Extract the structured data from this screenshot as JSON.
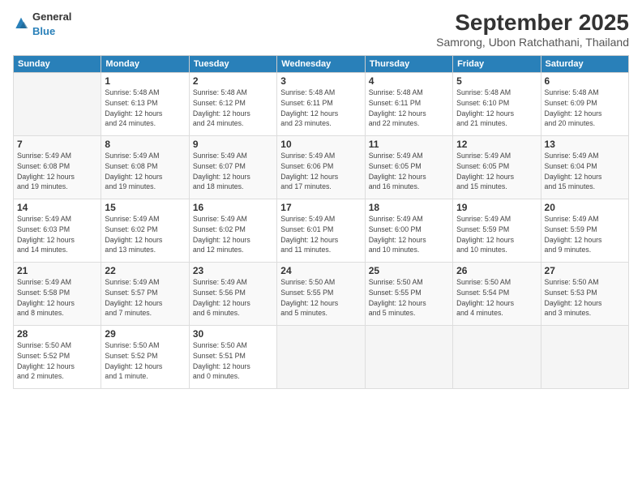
{
  "header": {
    "logo_general": "General",
    "logo_blue": "Blue",
    "month_title": "September 2025",
    "subtitle": "Samrong, Ubon Ratchathani, Thailand"
  },
  "weekdays": [
    "Sunday",
    "Monday",
    "Tuesday",
    "Wednesday",
    "Thursday",
    "Friday",
    "Saturday"
  ],
  "weeks": [
    [
      {
        "day": "",
        "info": ""
      },
      {
        "day": "1",
        "info": "Sunrise: 5:48 AM\nSunset: 6:13 PM\nDaylight: 12 hours\nand 24 minutes."
      },
      {
        "day": "2",
        "info": "Sunrise: 5:48 AM\nSunset: 6:12 PM\nDaylight: 12 hours\nand 24 minutes."
      },
      {
        "day": "3",
        "info": "Sunrise: 5:48 AM\nSunset: 6:11 PM\nDaylight: 12 hours\nand 23 minutes."
      },
      {
        "day": "4",
        "info": "Sunrise: 5:48 AM\nSunset: 6:11 PM\nDaylight: 12 hours\nand 22 minutes."
      },
      {
        "day": "5",
        "info": "Sunrise: 5:48 AM\nSunset: 6:10 PM\nDaylight: 12 hours\nand 21 minutes."
      },
      {
        "day": "6",
        "info": "Sunrise: 5:48 AM\nSunset: 6:09 PM\nDaylight: 12 hours\nand 20 minutes."
      }
    ],
    [
      {
        "day": "7",
        "info": "Sunrise: 5:49 AM\nSunset: 6:08 PM\nDaylight: 12 hours\nand 19 minutes."
      },
      {
        "day": "8",
        "info": "Sunrise: 5:49 AM\nSunset: 6:08 PM\nDaylight: 12 hours\nand 19 minutes."
      },
      {
        "day": "9",
        "info": "Sunrise: 5:49 AM\nSunset: 6:07 PM\nDaylight: 12 hours\nand 18 minutes."
      },
      {
        "day": "10",
        "info": "Sunrise: 5:49 AM\nSunset: 6:06 PM\nDaylight: 12 hours\nand 17 minutes."
      },
      {
        "day": "11",
        "info": "Sunrise: 5:49 AM\nSunset: 6:05 PM\nDaylight: 12 hours\nand 16 minutes."
      },
      {
        "day": "12",
        "info": "Sunrise: 5:49 AM\nSunset: 6:05 PM\nDaylight: 12 hours\nand 15 minutes."
      },
      {
        "day": "13",
        "info": "Sunrise: 5:49 AM\nSunset: 6:04 PM\nDaylight: 12 hours\nand 15 minutes."
      }
    ],
    [
      {
        "day": "14",
        "info": "Sunrise: 5:49 AM\nSunset: 6:03 PM\nDaylight: 12 hours\nand 14 minutes."
      },
      {
        "day": "15",
        "info": "Sunrise: 5:49 AM\nSunset: 6:02 PM\nDaylight: 12 hours\nand 13 minutes."
      },
      {
        "day": "16",
        "info": "Sunrise: 5:49 AM\nSunset: 6:02 PM\nDaylight: 12 hours\nand 12 minutes."
      },
      {
        "day": "17",
        "info": "Sunrise: 5:49 AM\nSunset: 6:01 PM\nDaylight: 12 hours\nand 11 minutes."
      },
      {
        "day": "18",
        "info": "Sunrise: 5:49 AM\nSunset: 6:00 PM\nDaylight: 12 hours\nand 10 minutes."
      },
      {
        "day": "19",
        "info": "Sunrise: 5:49 AM\nSunset: 5:59 PM\nDaylight: 12 hours\nand 10 minutes."
      },
      {
        "day": "20",
        "info": "Sunrise: 5:49 AM\nSunset: 5:59 PM\nDaylight: 12 hours\nand 9 minutes."
      }
    ],
    [
      {
        "day": "21",
        "info": "Sunrise: 5:49 AM\nSunset: 5:58 PM\nDaylight: 12 hours\nand 8 minutes."
      },
      {
        "day": "22",
        "info": "Sunrise: 5:49 AM\nSunset: 5:57 PM\nDaylight: 12 hours\nand 7 minutes."
      },
      {
        "day": "23",
        "info": "Sunrise: 5:49 AM\nSunset: 5:56 PM\nDaylight: 12 hours\nand 6 minutes."
      },
      {
        "day": "24",
        "info": "Sunrise: 5:50 AM\nSunset: 5:55 PM\nDaylight: 12 hours\nand 5 minutes."
      },
      {
        "day": "25",
        "info": "Sunrise: 5:50 AM\nSunset: 5:55 PM\nDaylight: 12 hours\nand 5 minutes."
      },
      {
        "day": "26",
        "info": "Sunrise: 5:50 AM\nSunset: 5:54 PM\nDaylight: 12 hours\nand 4 minutes."
      },
      {
        "day": "27",
        "info": "Sunrise: 5:50 AM\nSunset: 5:53 PM\nDaylight: 12 hours\nand 3 minutes."
      }
    ],
    [
      {
        "day": "28",
        "info": "Sunrise: 5:50 AM\nSunset: 5:52 PM\nDaylight: 12 hours\nand 2 minutes."
      },
      {
        "day": "29",
        "info": "Sunrise: 5:50 AM\nSunset: 5:52 PM\nDaylight: 12 hours\nand 1 minute."
      },
      {
        "day": "30",
        "info": "Sunrise: 5:50 AM\nSunset: 5:51 PM\nDaylight: 12 hours\nand 0 minutes."
      },
      {
        "day": "",
        "info": ""
      },
      {
        "day": "",
        "info": ""
      },
      {
        "day": "",
        "info": ""
      },
      {
        "day": "",
        "info": ""
      }
    ]
  ]
}
